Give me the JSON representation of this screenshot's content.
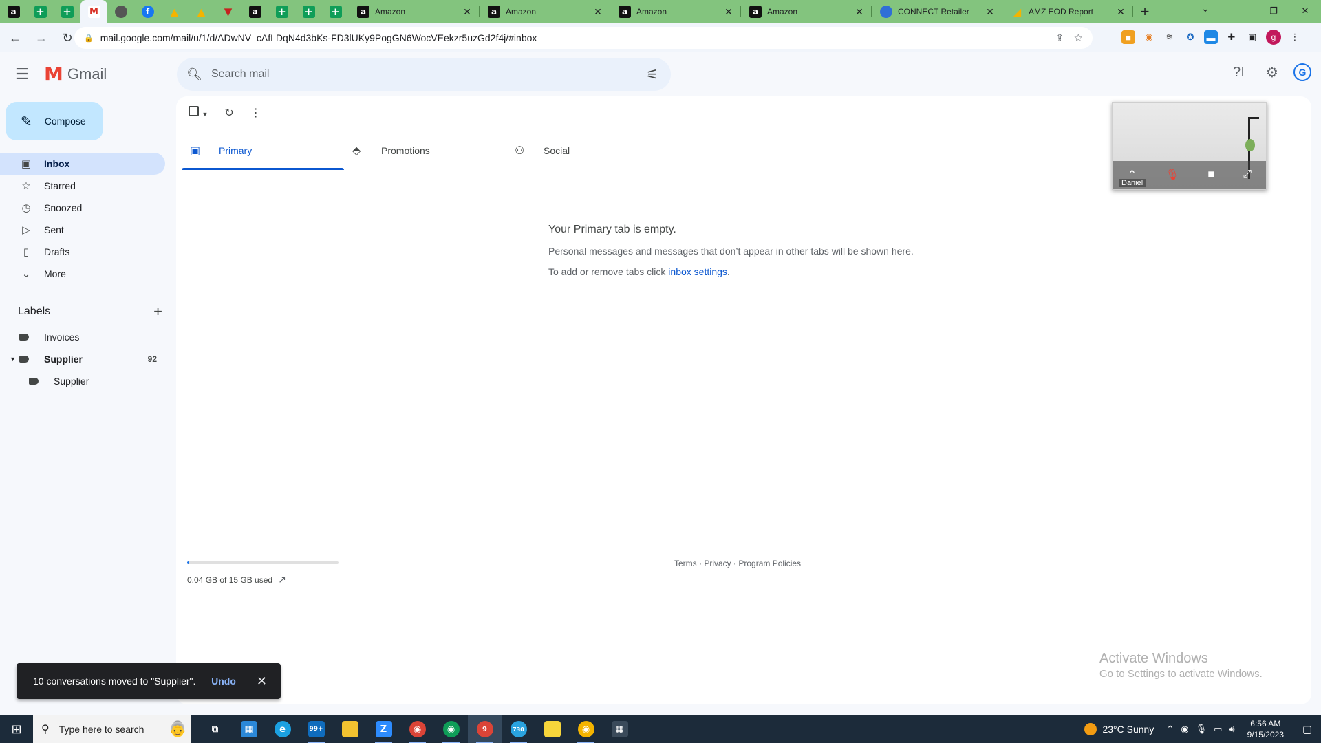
{
  "browser": {
    "tabs": [
      {
        "title": "Amazon"
      },
      {
        "title": "Amazon"
      },
      {
        "title": "Amazon"
      },
      {
        "title": "Amazon"
      },
      {
        "title": "CONNECT Retailer"
      },
      {
        "title": "AMZ EOD Report"
      }
    ],
    "url": "mail.google.com/mail/u/1/d/ADwNV_cAfLDqN4d3bKs-FD3lUKy9PogGN6WocVEekzr5uzGd2f4j/#inbox",
    "profile_initial": "g"
  },
  "gmail": {
    "logo_text": "Gmail",
    "search_placeholder": "Search mail",
    "compose_label": "Compose",
    "nav": [
      {
        "label": "Inbox",
        "icon": "inbox-icon"
      },
      {
        "label": "Starred",
        "icon": "star-icon"
      },
      {
        "label": "Snoozed",
        "icon": "clock-icon"
      },
      {
        "label": "Sent",
        "icon": "send-icon"
      },
      {
        "label": "Drafts",
        "icon": "draft-icon"
      },
      {
        "label": "More",
        "icon": "chevron-down-icon"
      }
    ],
    "labels_heading": "Labels",
    "labels": [
      {
        "name": "Invoices",
        "count": ""
      },
      {
        "name": "Supplier",
        "count": "92"
      },
      {
        "name": "Supplier",
        "count": ""
      }
    ],
    "tabs": [
      {
        "label": "Primary",
        "icon": "inbox-icon"
      },
      {
        "label": "Promotions",
        "icon": "tag-icon"
      },
      {
        "label": "Social",
        "icon": "people-icon"
      }
    ],
    "empty": {
      "title": "Your Primary tab is empty.",
      "line1": "Personal messages and messages that don’t appear in other tabs will be shown here.",
      "line2_prefix": "To add or remove tabs click ",
      "line2_link": "inbox settings",
      "line2_suffix": "."
    },
    "storage_text": "0.04 GB of 15 GB used",
    "storage_fraction": 0.003,
    "footer": {
      "terms": "Terms",
      "privacy": "Privacy",
      "policies": "Program Policies"
    },
    "snackbar": {
      "message": "10 conversations moved to \"Supplier\".",
      "undo": "Undo"
    },
    "video_overlay": {
      "name": "Daniel"
    }
  },
  "watermark": {
    "line1": "Activate Windows",
    "line2": "Go to Settings to activate Windows."
  },
  "taskbar": {
    "search_placeholder": "Type here to search",
    "weather": "23°C  Sunny",
    "time": "6:56 AM",
    "date": "9/15/2023",
    "mail_badge": "99+",
    "chrome_badge": "9",
    "telegram_badge": "730"
  }
}
